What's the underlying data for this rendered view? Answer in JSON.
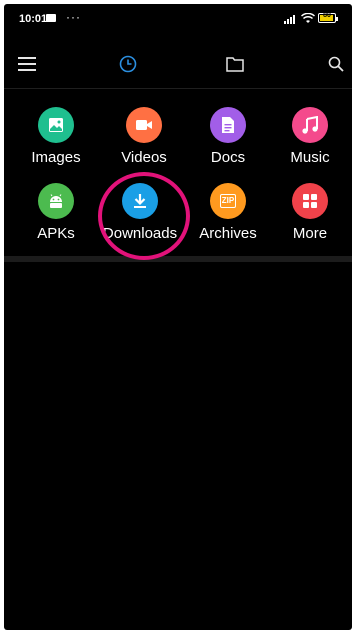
{
  "status": {
    "time": "10:01",
    "dots": "···",
    "battery_level": "80"
  },
  "categories": [
    {
      "label": "Images",
      "color": "#1fbf8f",
      "icon": "image-icon"
    },
    {
      "label": "Videos",
      "color": "#ff7043",
      "icon": "video-icon"
    },
    {
      "label": "Docs",
      "color": "#a25ee8",
      "icon": "document-icon"
    },
    {
      "label": "Music",
      "color": "#f44a8c",
      "icon": "music-icon"
    },
    {
      "label": "APKs",
      "color": "#4cbb4f",
      "icon": "android-icon"
    },
    {
      "label": "Downloads",
      "color": "#1a9fe6",
      "icon": "download-icon"
    },
    {
      "label": "Archives",
      "color": "#ff9a1f",
      "icon": "zip-icon",
      "badge": "ZIP"
    },
    {
      "label": "More",
      "color": "#f0424a",
      "icon": "grid-icon"
    }
  ],
  "colors": {
    "highlight": "#e2127a",
    "accent": "#2b8fe0"
  }
}
